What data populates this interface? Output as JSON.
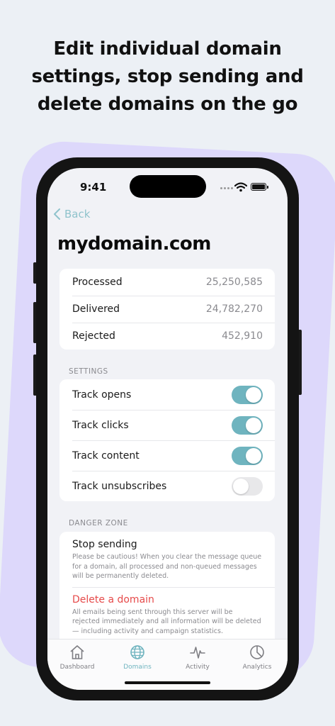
{
  "headline": {
    "line1": "Edit individual domain",
    "line2": "settings, stop sending and",
    "line3": "delete domains on the go"
  },
  "status_bar": {
    "time": "9:41"
  },
  "nav": {
    "back_label": "Back"
  },
  "domain": {
    "name": "mydomain.com"
  },
  "stats": [
    {
      "label": "Processed",
      "value": "25,250,585"
    },
    {
      "label": "Delivered",
      "value": "24,782,270"
    },
    {
      "label": "Rejected",
      "value": "452,910"
    }
  ],
  "settings": {
    "header": "SETTINGS",
    "items": [
      {
        "label": "Track opens",
        "on": true
      },
      {
        "label": "Track clicks",
        "on": true
      },
      {
        "label": "Track content",
        "on": true
      },
      {
        "label": "Track unsubscribes",
        "on": false
      }
    ]
  },
  "danger_zone": {
    "header": "DANGER ZONE",
    "stop": {
      "title": "Stop sending",
      "description": "Please be cautious! When you clear the message queue for a domain, all processed and non-queued messages will be permanently deleted."
    },
    "delete": {
      "title": "Delete a domain",
      "description": "All emails being sent through this server will be rejected immediately and all information will be deleted — including activity and campaign statistics."
    }
  },
  "tabs": [
    {
      "label": "Dashboard",
      "icon": "house-icon",
      "active": false
    },
    {
      "label": "Domains",
      "icon": "globe-icon",
      "active": true
    },
    {
      "label": "Activity",
      "icon": "pulse-icon",
      "active": false
    },
    {
      "label": "Analytics",
      "icon": "pie-chart-icon",
      "active": false
    }
  ],
  "colors": {
    "accent": "#6fb4bf",
    "danger": "#e64a4a",
    "background_blob": "#ddd8fb",
    "page_background": "#ecf0f5"
  }
}
